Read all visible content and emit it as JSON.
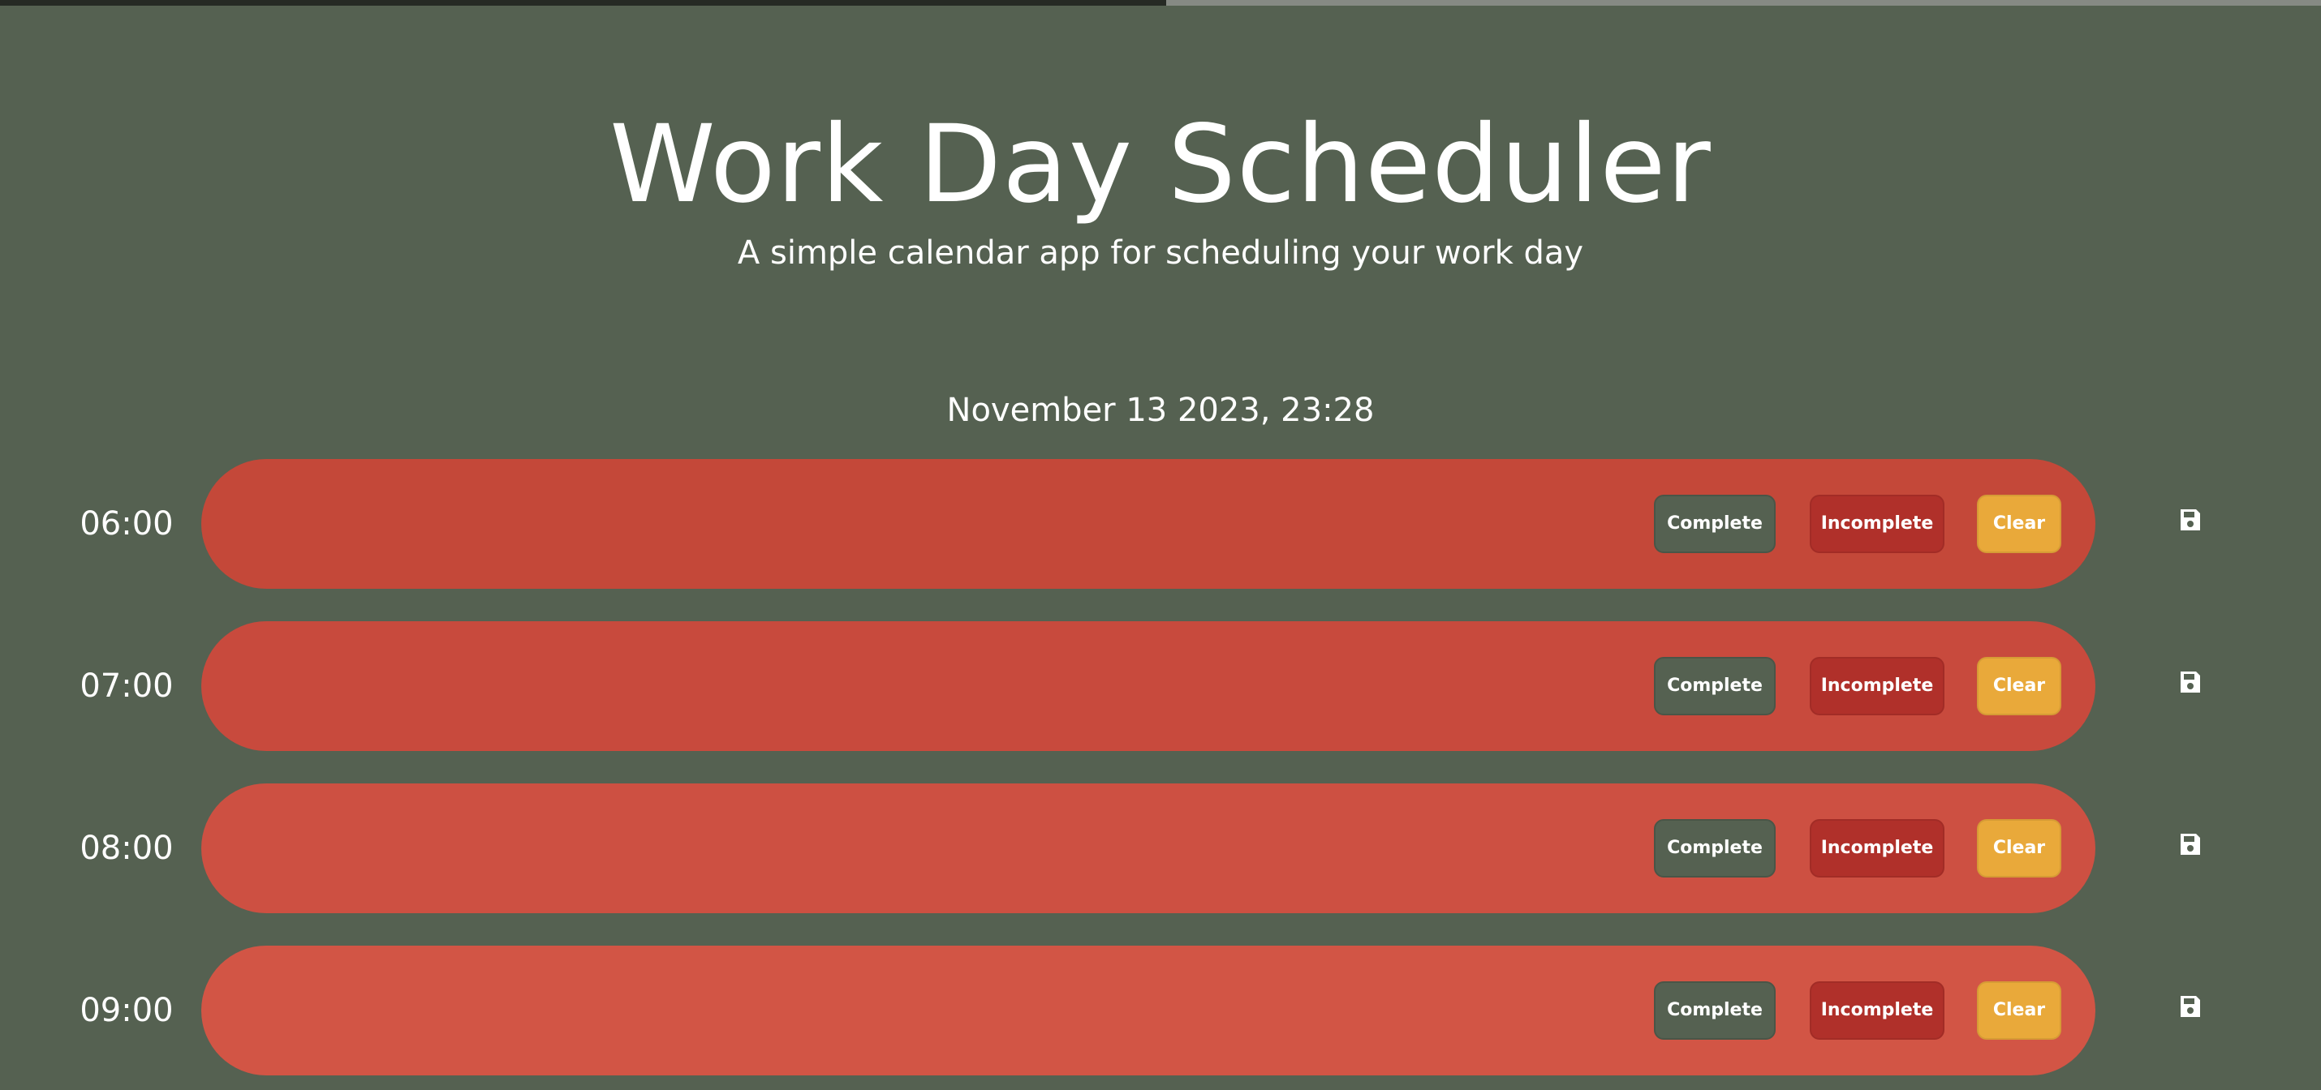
{
  "header": {
    "title": "Work Day Scheduler",
    "subtitle": "A simple calendar app for scheduling your work day"
  },
  "current_date": "November 13 2023, 23:28",
  "colors": {
    "background": "#556151",
    "complete_button": "#556151",
    "incomplete_button": "#b0302a",
    "clear_button": "#e9a93a"
  },
  "rows": [
    {
      "time": "06:00",
      "task": "",
      "color": "#c44839",
      "complete_label": "Complete",
      "incomplete_label": "Incomplete",
      "clear_label": "Clear",
      "save_icon": "save-icon"
    },
    {
      "time": "07:00",
      "task": "",
      "color": "#c84a3d",
      "complete_label": "Complete",
      "incomplete_label": "Incomplete",
      "clear_label": "Clear",
      "save_icon": "save-icon"
    },
    {
      "time": "08:00",
      "task": "",
      "color": "#cd5042",
      "complete_label": "Complete",
      "incomplete_label": "Incomplete",
      "clear_label": "Clear",
      "save_icon": "save-icon"
    },
    {
      "time": "09:00",
      "task": "",
      "color": "#d25545",
      "complete_label": "Complete",
      "incomplete_label": "Incomplete",
      "clear_label": "Clear",
      "save_icon": "save-icon"
    }
  ]
}
